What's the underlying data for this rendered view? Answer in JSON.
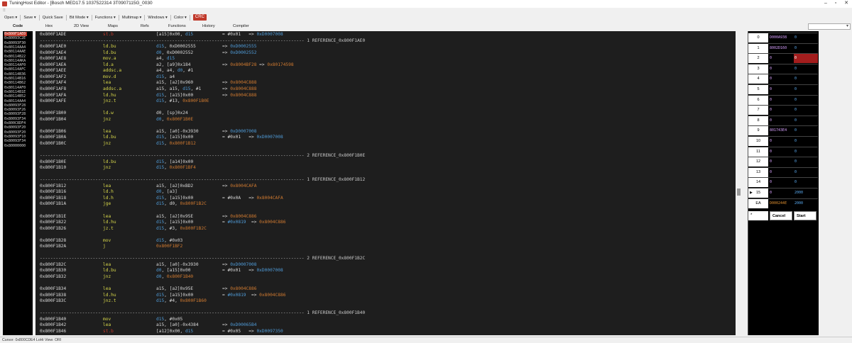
{
  "window": {
    "title": "TuningHost Editor - [Bosch MED17.5 1037522314 3T0907115G_0030",
    "controls": [
      "–",
      "▫",
      "✕"
    ]
  },
  "grip": "⁝⁝",
  "menu": [
    {
      "label": "Open ▾"
    },
    {
      "label": "Save ▾"
    },
    {
      "label": "Quick Save"
    },
    {
      "label": "Bit Mode ▾"
    },
    {
      "label": "Functions ▾"
    },
    {
      "label": "Multimap ▾"
    },
    {
      "label": "Windows ▾"
    },
    {
      "label": "Color ▾"
    }
  ],
  "crc_label": "CRC",
  "tabs": [
    "Code",
    "Hex",
    "2D View",
    "Maps",
    "Refs",
    "Functions",
    "History",
    "Compiler"
  ],
  "active_tab": "Code",
  "address_list": [
    "0x800F1AE0",
    "0x80093C2E",
    "0x80093F30",
    "0x80114AA4",
    "0x80114AAE",
    "0x80114B22",
    "0x80114AKA",
    "0x80114AF0",
    "0x80114AFC",
    "0x80114B36",
    "0x80114B16",
    "0x80114B62",
    "0x80114AF0",
    "0x80114B1E",
    "0x80114B52",
    "0x80114AA4",
    "0x80093F28",
    "0x80093F26",
    "0x80093F28",
    "0x80093F34",
    "0x800C8DF4",
    "0x80093F20",
    "0x80093F20",
    "0x80093F10",
    "0x80093F34",
    "0x80000000"
  ],
  "code_rows": [
    {
      "addr": "0x800F1ADE",
      "mnem": "st.b",
      "mnem_color": "red",
      "ops": [
        {
          "t": "[a15]0x00, ",
          "c": "op"
        },
        {
          "t": "d15",
          "c": "reg"
        }
      ],
      "cmt": [
        {
          "t": "= #0x01",
          "c": "op"
        },
        {
          "t": "   => ",
          "c": "op"
        },
        {
          "t": "0xD0007008",
          "c": "ref"
        }
      ]
    },
    {
      "sep": "---------------------------------------------------------------------------------------------------- 1 REFERENCE_0x800F1AE0"
    },
    {
      "addr": "0x800F1AE0",
      "mnem": "ld.bu",
      "ops": [
        {
          "t": "d15",
          "c": "reg"
        },
        {
          "t": ", 0xD0002555",
          "c": "op"
        }
      ],
      "cmt": [
        {
          "t": "=> ",
          "c": "op"
        },
        {
          "t": "0xD0002555",
          "c": "ref"
        }
      ]
    },
    {
      "addr": "0x800F1AE4",
      "mnem": "ld.bu",
      "ops": [
        {
          "t": "d0",
          "c": "reg"
        },
        {
          "t": ", 0xD0002552",
          "c": "op"
        }
      ],
      "cmt": [
        {
          "t": "=> ",
          "c": "op"
        },
        {
          "t": "0xD0002552",
          "c": "ref"
        }
      ]
    },
    {
      "addr": "0x800F1AE8",
      "mnem": "mov.a",
      "ops": [
        {
          "t": "a4, ",
          "c": "op"
        },
        {
          "t": "d15",
          "c": "reg"
        }
      ],
      "cmt": []
    },
    {
      "addr": "0x800F1AEA",
      "mnem": "ld.a",
      "ops": [
        {
          "t": "a2, [a9]0x184",
          "c": "op"
        }
      ],
      "cmt": [
        {
          "t": "=> ",
          "c": "op"
        },
        {
          "t": "0x8004BF28",
          "c": "lab"
        },
        {
          "t": " => ",
          "c": "op"
        },
        {
          "t": "0x80174598",
          "c": "lab"
        }
      ]
    },
    {
      "addr": "0x800F1AEE",
      "mnem": "addsc.a",
      "ops": [
        {
          "t": "a4, a4, ",
          "c": "op"
        },
        {
          "t": "d0",
          "c": "reg"
        },
        {
          "t": ", #1",
          "c": "op"
        }
      ],
      "cmt": []
    },
    {
      "addr": "0x800F1AF2",
      "mnem": "mov.d",
      "ops": [
        {
          "t": "d15",
          "c": "reg"
        },
        {
          "t": ", a4",
          "c": "op"
        }
      ],
      "cmt": []
    },
    {
      "addr": "0x800F1AF4",
      "mnem": "lea",
      "ops": [
        {
          "t": "a15, [a2]0x960",
          "c": "op"
        }
      ],
      "cmt": [
        {
          "t": "=> ",
          "c": "op"
        },
        {
          "t": "0x8004C888",
          "c": "lab"
        }
      ]
    },
    {
      "addr": "0x800F1AF8",
      "mnem": "addsc.a",
      "ops": [
        {
          "t": "a15, a15, ",
          "c": "op"
        },
        {
          "t": "d15",
          "c": "reg"
        },
        {
          "t": ", #1",
          "c": "op"
        }
      ],
      "cmt": [
        {
          "t": "=> ",
          "c": "op"
        },
        {
          "t": "0x8004C888",
          "c": "lab"
        }
      ]
    },
    {
      "addr": "0x800F1AFA",
      "mnem": "ld.hu",
      "ops": [
        {
          "t": "d15",
          "c": "reg"
        },
        {
          "t": ", [a15]0x00",
          "c": "op"
        }
      ],
      "cmt": [
        {
          "t": "=> ",
          "c": "op"
        },
        {
          "t": "0x8004C888",
          "c": "lab"
        }
      ]
    },
    {
      "addr": "0x800F1AFE",
      "mnem": "jnz.t",
      "ops": [
        {
          "t": "d15",
          "c": "reg"
        },
        {
          "t": ", #13, ",
          "c": "op"
        },
        {
          "t": "0x800F1B0E",
          "c": "lab"
        }
      ],
      "cmt": []
    },
    {
      "blank": true
    },
    {
      "addr": "0x800F1B00",
      "mnem": "ld.w",
      "ops": [
        {
          "t": "d0, [sp]0x24",
          "c": "op"
        }
      ],
      "cmt": []
    },
    {
      "addr": "0x800F1B04",
      "mnem": "jnz",
      "ops": [
        {
          "t": "d0",
          "c": "reg"
        },
        {
          "t": ", ",
          "c": "op"
        },
        {
          "t": "0x800F1B0E",
          "c": "lab"
        }
      ],
      "cmt": []
    },
    {
      "blank": true
    },
    {
      "addr": "0x800F1B06",
      "mnem": "lea",
      "ops": [
        {
          "t": "a15, [a0]-0x3930",
          "c": "op"
        }
      ],
      "cmt": [
        {
          "t": "=> ",
          "c": "op"
        },
        {
          "t": "0xD0007008",
          "c": "ref"
        }
      ]
    },
    {
      "addr": "0x800F1B0A",
      "mnem": "ld.bu",
      "ops": [
        {
          "t": "d15",
          "c": "reg"
        },
        {
          "t": ", [a15]0x00",
          "c": "op"
        }
      ],
      "cmt": [
        {
          "t": "= #0x01",
          "c": "op"
        },
        {
          "t": "   => ",
          "c": "op"
        },
        {
          "t": "0xD0007008",
          "c": "ref"
        }
      ]
    },
    {
      "addr": "0x800F1B0C",
      "mnem": "jnz",
      "ops": [
        {
          "t": "d15",
          "c": "reg"
        },
        {
          "t": ", ",
          "c": "op"
        },
        {
          "t": "0x800F1B12",
          "c": "lab"
        }
      ],
      "cmt": []
    },
    {
      "blank": true
    },
    {
      "sep": "---------------------------------------------------------------------------------------------------- 2 REFERENCE_0x800F1B0E"
    },
    {
      "addr": "0x800F1B0E",
      "mnem": "ld.bu",
      "ops": [
        {
          "t": "d15",
          "c": "reg"
        },
        {
          "t": ", [a14]0x00",
          "c": "op"
        }
      ],
      "cmt": []
    },
    {
      "addr": "0x800F1B10",
      "mnem": "jnz",
      "ops": [
        {
          "t": "d15",
          "c": "reg"
        },
        {
          "t": ", ",
          "c": "op"
        },
        {
          "t": "0x800F1BF4",
          "c": "lab"
        }
      ],
      "cmt": []
    },
    {
      "blank": true
    },
    {
      "sep": "---------------------------------------------------------------------------------------------------- 1 REFERENCE_0x800F1B12"
    },
    {
      "addr": "0x800F1B12",
      "mnem": "lea",
      "ops": [
        {
          "t": "a15, [a2]0xBD2",
          "c": "op"
        }
      ],
      "cmt": [
        {
          "t": "=> ",
          "c": "op"
        },
        {
          "t": "0x8004CAFA",
          "c": "lab"
        }
      ]
    },
    {
      "addr": "0x800F1B16",
      "mnem": "ld.h",
      "ops": [
        {
          "t": "d0",
          "c": "reg"
        },
        {
          "t": ", [a3]",
          "c": "op"
        }
      ],
      "cmt": []
    },
    {
      "addr": "0x800F1B18",
      "mnem": "ld.h",
      "ops": [
        {
          "t": "d15",
          "c": "reg"
        },
        {
          "t": ", [a15]0x00",
          "c": "op"
        }
      ],
      "cmt": [
        {
          "t": "= #0x0A",
          "c": "op"
        },
        {
          "t": "   => ",
          "c": "op"
        },
        {
          "t": "0x8004CAFA",
          "c": "lab"
        }
      ]
    },
    {
      "addr": "0x800F1B1A",
      "mnem": "jge",
      "ops": [
        {
          "t": "d15",
          "c": "reg"
        },
        {
          "t": ", d0, ",
          "c": "op"
        },
        {
          "t": "0x800F1B2C",
          "c": "lab"
        }
      ],
      "cmt": []
    },
    {
      "blank": true
    },
    {
      "addr": "0x800F1B1E",
      "mnem": "lea",
      "ops": [
        {
          "t": "a15, [a2]0x95E",
          "c": "op"
        }
      ],
      "cmt": [
        {
          "t": "=> ",
          "c": "op"
        },
        {
          "t": "0x8004C886",
          "c": "lab"
        }
      ]
    },
    {
      "addr": "0x800F1B22",
      "mnem": "ld.hu",
      "ops": [
        {
          "t": "d15",
          "c": "reg"
        },
        {
          "t": ", [a15]0x00",
          "c": "op"
        }
      ],
      "cmt": [
        {
          "t": "= ",
          "c": "op"
        },
        {
          "t": "#0x0819",
          "c": "ref"
        },
        {
          "t": "  => ",
          "c": "op"
        },
        {
          "t": "0x8004C886",
          "c": "lab"
        }
      ]
    },
    {
      "addr": "0x800F1B26",
      "mnem": "jz.t",
      "ops": [
        {
          "t": "d15",
          "c": "reg"
        },
        {
          "t": ", #3, ",
          "c": "op"
        },
        {
          "t": "0x800F1B2C",
          "c": "lab"
        }
      ],
      "cmt": []
    },
    {
      "blank": true
    },
    {
      "addr": "0x800F1B28",
      "mnem": "mov",
      "ops": [
        {
          "t": "d15",
          "c": "reg"
        },
        {
          "t": ", #0x03",
          "c": "op"
        }
      ],
      "cmt": []
    },
    {
      "addr": "0x800F1B2A",
      "mnem": "j",
      "ops": [
        {
          "t": "0x800F1BF2",
          "c": "lab"
        }
      ],
      "cmt": []
    },
    {
      "blank": true
    },
    {
      "sep": "---------------------------------------------------------------------------------------------------- 2 REFERENCE_0x800F1B2C"
    },
    {
      "addr": "0x800F1B2C",
      "mnem": "lea",
      "ops": [
        {
          "t": "a15, [a0]-0x3930",
          "c": "op"
        }
      ],
      "cmt": [
        {
          "t": "=> ",
          "c": "op"
        },
        {
          "t": "0xD0007008",
          "c": "ref"
        }
      ]
    },
    {
      "addr": "0x800F1B30",
      "mnem": "ld.bu",
      "ops": [
        {
          "t": "d0",
          "c": "reg"
        },
        {
          "t": ", [a15]0x00",
          "c": "op"
        }
      ],
      "cmt": [
        {
          "t": "= #0x01",
          "c": "op"
        },
        {
          "t": "   => ",
          "c": "op"
        },
        {
          "t": "0xD0007008",
          "c": "ref"
        }
      ]
    },
    {
      "addr": "0x800F1B32",
      "mnem": "jnz",
      "ops": [
        {
          "t": "d0",
          "c": "reg"
        },
        {
          "t": ", ",
          "c": "op"
        },
        {
          "t": "0x800F1B40",
          "c": "lab"
        }
      ],
      "cmt": []
    },
    {
      "blank": true
    },
    {
      "addr": "0x800F1B34",
      "mnem": "lea",
      "ops": [
        {
          "t": "a15, [a2]0x95E",
          "c": "op"
        }
      ],
      "cmt": [
        {
          "t": "=> ",
          "c": "op"
        },
        {
          "t": "0x8004C886",
          "c": "lab"
        }
      ]
    },
    {
      "addr": "0x800F1B38",
      "mnem": "ld.hu",
      "ops": [
        {
          "t": "d15",
          "c": "reg"
        },
        {
          "t": ", [a15]0x00",
          "c": "op"
        }
      ],
      "cmt": [
        {
          "t": "= ",
          "c": "op"
        },
        {
          "t": "#0x0819",
          "c": "ref"
        },
        {
          "t": "  => ",
          "c": "op"
        },
        {
          "t": "0x8004C886",
          "c": "lab"
        }
      ]
    },
    {
      "addr": "0x800F1B3C",
      "mnem": "jnz.t",
      "ops": [
        {
          "t": "d15",
          "c": "reg"
        },
        {
          "t": ", #4, ",
          "c": "op"
        },
        {
          "t": "0x800F1B60",
          "c": "lab"
        }
      ],
      "cmt": []
    },
    {
      "blank": true
    },
    {
      "sep": "---------------------------------------------------------------------------------------------------- 1 REFERENCE_0x800F1B40"
    },
    {
      "addr": "0x800F1B40",
      "mnem": "mov",
      "ops": [
        {
          "t": "d15",
          "c": "reg"
        },
        {
          "t": ", #0x05",
          "c": "op"
        }
      ],
      "cmt": []
    },
    {
      "addr": "0x800F1B42",
      "mnem": "lea",
      "ops": [
        {
          "t": "a15, [a0]-0x4384",
          "c": "op"
        }
      ],
      "cmt": [
        {
          "t": "=> ",
          "c": "op"
        },
        {
          "t": "0xD00065B4",
          "c": "ref"
        }
      ]
    },
    {
      "addr": "0x800F1B46",
      "mnem": "st.b",
      "mnem_color": "red",
      "ops": [
        {
          "t": "[a12]0x00, ",
          "c": "op"
        },
        {
          "t": "d15",
          "c": "reg"
        }
      ],
      "cmt": [
        {
          "t": "= #0x05",
          "c": "op"
        },
        {
          "t": "   => ",
          "c": "op"
        },
        {
          "t": "0xD0097350",
          "c": "ref"
        }
      ]
    }
  ],
  "registers": [
    {
      "idx": "0",
      "v1": "D000A938",
      "v2": "0"
    },
    {
      "idx": "1",
      "v1": "8002D160",
      "v2": "0"
    },
    {
      "idx": "2",
      "v1": "0",
      "v2": "0",
      "v2_highlight": true
    },
    {
      "idx": "3",
      "v1": "0",
      "v2": "0"
    },
    {
      "idx": "4",
      "v1": "0",
      "v2": "0"
    },
    {
      "idx": "5",
      "v1": "0",
      "v2": "0"
    },
    {
      "idx": "6",
      "v1": "0",
      "v2": "0"
    },
    {
      "idx": "7",
      "v1": "0",
      "v2": "0"
    },
    {
      "idx": "8",
      "v1": "0",
      "v2": "0"
    },
    {
      "idx": "9",
      "v1": "801743E4",
      "v2": "0"
    },
    {
      "idx": "10",
      "v1": "0",
      "v2": "0"
    },
    {
      "idx": "11",
      "v1": "0",
      "v2": "0"
    },
    {
      "idx": "12",
      "v1": "0",
      "v2": "0"
    },
    {
      "idx": "13",
      "v1": "0",
      "v2": "0"
    },
    {
      "idx": "14",
      "v1": "0",
      "v2": "0"
    },
    {
      "idx": "15",
      "v1": "0",
      "v2": "2000",
      "arrow": true
    },
    {
      "idx": "EA",
      "v1": "D000244E",
      "v2": "2000",
      "v1_orange": true
    }
  ],
  "command": {
    "input": "*",
    "cancel": "Cancel",
    "start": "Start"
  },
  "status": "Cursor: 0x800CDE4  LoHi  View: ORI",
  "colors": {
    "accent": "#c0392b",
    "reg_blue": "#4f9ad6",
    "mnemonic": "#d6d64a",
    "label_orange": "#d07a30",
    "code_bg": "#1e1e1e"
  }
}
